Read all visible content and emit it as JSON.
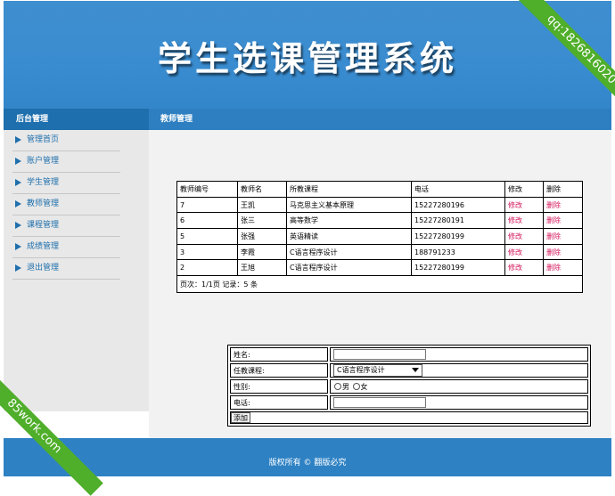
{
  "header": {
    "title": "学生选课管理系统"
  },
  "watermarks": {
    "top_right": "qq:1826816020",
    "bottom_left": "85work.com"
  },
  "sidebar": {
    "title": "后台管理",
    "items": [
      {
        "label": "管理首页"
      },
      {
        "label": "账户管理"
      },
      {
        "label": "学生管理"
      },
      {
        "label": "教师管理"
      },
      {
        "label": "课程管理"
      },
      {
        "label": "成绩管理"
      },
      {
        "label": "退出管理"
      }
    ]
  },
  "main": {
    "title": "教师管理",
    "table": {
      "columns": [
        "教师编号",
        "教师名",
        "所教课程",
        "电话",
        "修改",
        "删除"
      ],
      "rows": [
        {
          "id": "7",
          "name": "王凯",
          "course": "马克思主义基本原理",
          "phone": "15227280196",
          "edit": "修改",
          "del": "删除"
        },
        {
          "id": "6",
          "name": "张三",
          "course": "高等数学",
          "phone": "15227280191",
          "edit": "修改",
          "del": "删除"
        },
        {
          "id": "5",
          "name": "张强",
          "course": "英语精读",
          "phone": "15227280199",
          "edit": "修改",
          "del": "删除"
        },
        {
          "id": "3",
          "name": "李霞",
          "course": "C语言程序设计",
          "phone": "188791233",
          "edit": "修改",
          "del": "删除"
        },
        {
          "id": "2",
          "name": "王旭",
          "course": "C语言程序设计",
          "phone": "15227280199",
          "edit": "修改",
          "del": "删除"
        }
      ],
      "pager": "页次：1/1页 记录：5 条"
    },
    "form": {
      "name_label": "姓名:",
      "name_value": "",
      "course_label": "任教课程:",
      "course_selected": "C语言程序设计",
      "gender_label": "性别:",
      "gender_male": "男",
      "gender_female": "女",
      "phone_label": "电话:",
      "phone_value": "",
      "submit_label": "添加"
    }
  },
  "footer": {
    "text": "版权所有 © 翻版必究"
  },
  "colors": {
    "header_blue": "#3a8cd0",
    "nav_blue": "#1e6fad",
    "link_red": "#d4145a",
    "ribbon_green": "#4fae2a"
  }
}
